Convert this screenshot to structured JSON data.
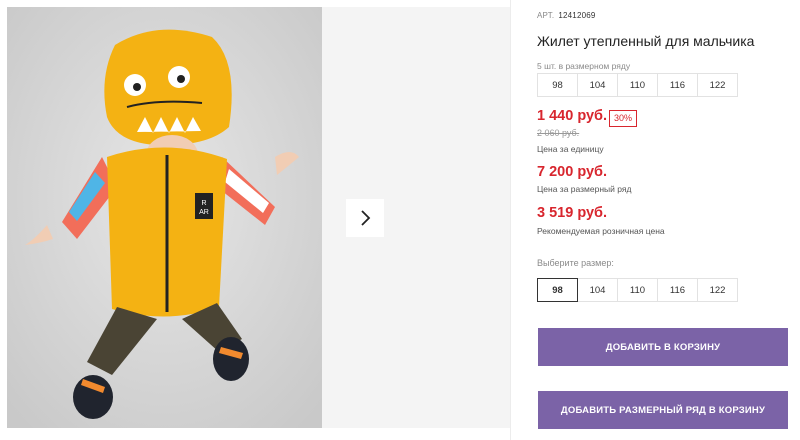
{
  "gallery": {
    "next_icon": "chevron-right-icon",
    "vest_badge_text": "R\nAR"
  },
  "product": {
    "sku_label": "АРТ.",
    "sku_value": "12412069",
    "title": "Жилет утепленный для мальчика",
    "pack_note": "5 шт. в размерном ряду",
    "pack_sizes": [
      "98",
      "104",
      "110",
      "116",
      "122"
    ]
  },
  "prices": {
    "main": "1 440 руб.",
    "discount": "30%",
    "old": "2 060 руб.",
    "main_note": "Цена за единицу",
    "pack": "7 200 руб.",
    "pack_note": "Цена за размерный ряд",
    "rrp": "3 519 руб.",
    "rrp_note": "Рекомендуемая розничная цена"
  },
  "size_picker": {
    "label": "Выберите размер:",
    "sizes": [
      "98",
      "104",
      "110",
      "116",
      "122"
    ],
    "selected": "98"
  },
  "actions": {
    "add_to_cart": "Добавить в корзину",
    "add_pack_to_cart": "Добавить размерный ряд в корзину"
  },
  "colors": {
    "price_red": "#d8262e",
    "button_purple": "#7b63a7",
    "vest_yellow": "#f4b213"
  }
}
